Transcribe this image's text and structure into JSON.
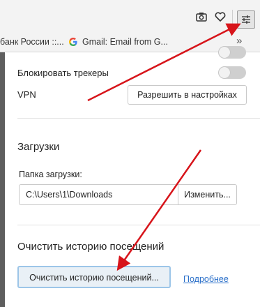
{
  "toolbar": {
    "icons": [
      "camera-icon",
      "heart-icon",
      "settings-menu-icon"
    ]
  },
  "bookmarks": {
    "items": [
      {
        "label": "банк России ::..."
      },
      {
        "label": "Gmail: Email from G...",
        "icon": "google-icon"
      }
    ],
    "more_label": "»"
  },
  "privacy": {
    "block_trackers_label": "Блокировать трекеры",
    "block_trackers_enabled": false,
    "vpn_label": "VPN",
    "vpn_button": "Разрешить в настройках"
  },
  "downloads": {
    "title": "Загрузки",
    "folder_label": "Папка загрузки:",
    "folder_value": "C:\\Users\\1\\Downloads",
    "change_button": "Изменить..."
  },
  "history": {
    "title": "Очистить историю посещений",
    "clear_button": "Очистить историю посещений...",
    "more_link": "Подробнее"
  },
  "colors": {
    "annotation_arrow": "#d7141a",
    "link": "#2a6fc9",
    "focus_border": "#9cc5e8"
  }
}
